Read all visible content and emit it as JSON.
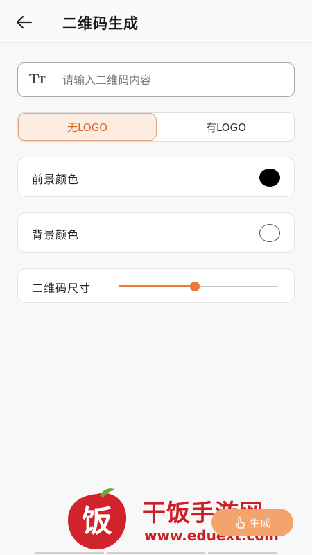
{
  "header": {
    "title": "二维码生成"
  },
  "input": {
    "placeholder": "请输入二维码内容",
    "icon": "text-format-icon"
  },
  "logo_toggle": {
    "options": [
      "无LOGO",
      "有LOGO"
    ],
    "selected": "无LOGO"
  },
  "foreground": {
    "label": "前景颜色",
    "color": "#000000"
  },
  "background": {
    "label": "背景颜色",
    "color": "#ffffff"
  },
  "size": {
    "label": "二维码尺寸",
    "value_fraction": 0.48
  },
  "actions": {
    "generate_label": "生成"
  },
  "watermark": {
    "name": "干饭手游网",
    "url": "www.eduext.com"
  },
  "colors": {
    "accent": "#ec7a36",
    "accent_light": "#fcece2"
  }
}
